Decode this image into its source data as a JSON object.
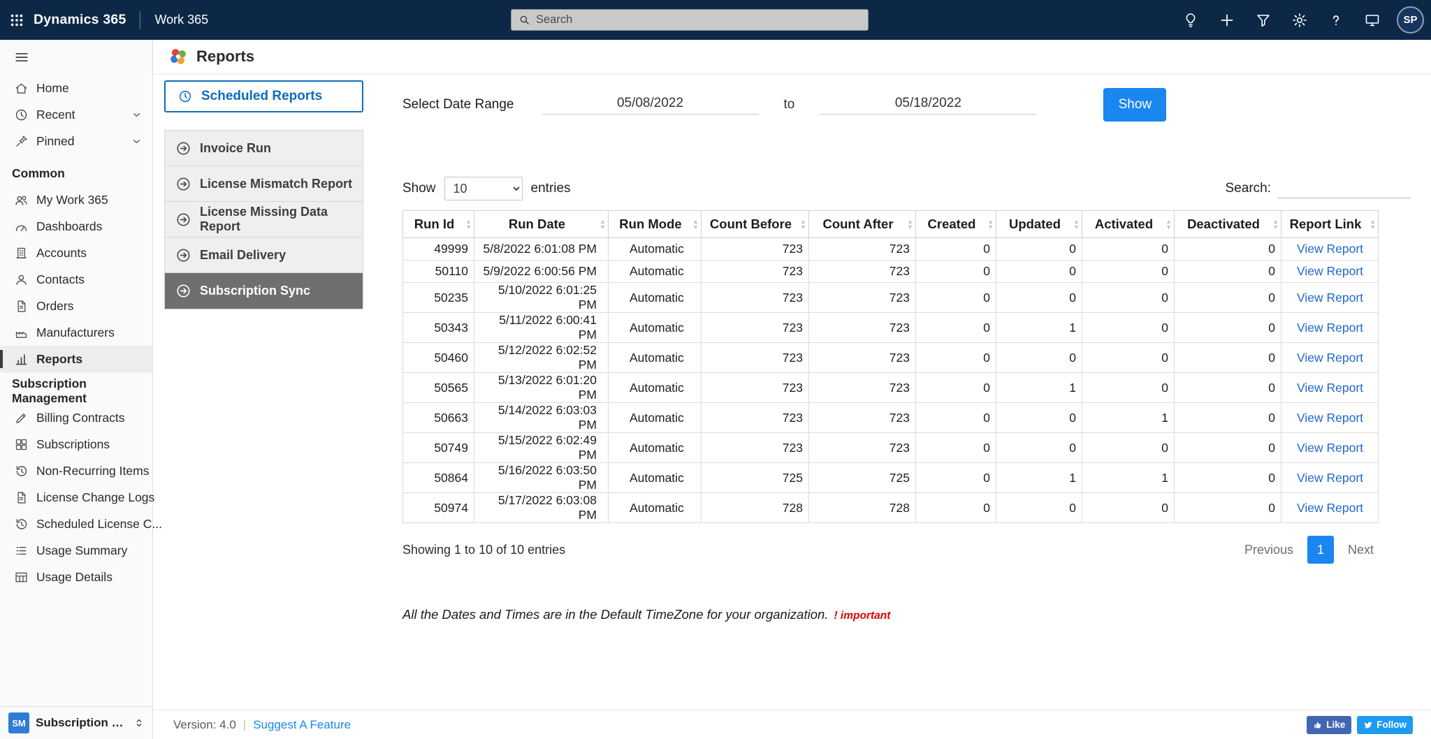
{
  "topbar": {
    "app_name": "Dynamics 365",
    "org_name": "Work 365",
    "search_placeholder": "Search",
    "avatar_initials": "SP"
  },
  "sidebar": {
    "items_top": [
      {
        "label": "Home",
        "icon": "home",
        "chevron": false
      },
      {
        "label": "Recent",
        "icon": "clock",
        "chevron": true
      },
      {
        "label": "Pinned",
        "icon": "pin",
        "chevron": true
      }
    ],
    "sections": [
      {
        "title": "Common",
        "items": [
          {
            "label": "My Work 365",
            "icon": "people"
          },
          {
            "label": "Dashboards",
            "icon": "gauge"
          },
          {
            "label": "Accounts",
            "icon": "building"
          },
          {
            "label": "Contacts",
            "icon": "person"
          },
          {
            "label": "Orders",
            "icon": "doc"
          },
          {
            "label": "Manufacturers",
            "icon": "factory"
          },
          {
            "label": "Reports",
            "icon": "chart"
          }
        ]
      },
      {
        "title": "Subscription Management",
        "items": [
          {
            "label": "Billing Contracts",
            "icon": "pen"
          },
          {
            "label": "Subscriptions",
            "icon": "grid"
          },
          {
            "label": "Non-Recurring Items",
            "icon": "history"
          },
          {
            "label": "License Change Logs",
            "icon": "doc"
          },
          {
            "label": "Scheduled License C...",
            "icon": "history"
          },
          {
            "label": "Usage Summary",
            "icon": "list"
          },
          {
            "label": "Usage Details",
            "icon": "table"
          }
        ]
      }
    ],
    "selected_item": "Reports",
    "footer": {
      "badge": "SM",
      "label": "Subscription Man..."
    }
  },
  "page": {
    "title": "Reports"
  },
  "report_nav": {
    "scheduled_label": "Scheduled Reports",
    "items": [
      "Invoice Run",
      "License Mismatch Report",
      "License Missing Data Report",
      "Email Delivery",
      "Subscription Sync"
    ],
    "selected": "Subscription Sync"
  },
  "filters": {
    "date_label": "Select Date Range",
    "date_from": "05/08/2022",
    "to_label": "to",
    "date_to": "05/18/2022",
    "show_button": "Show"
  },
  "table_controls": {
    "show_label": "Show",
    "page_size": "10",
    "entries_label": "entries",
    "search_label": "Search:"
  },
  "table": {
    "columns": [
      "Run Id",
      "Run Date",
      "Run Mode",
      "Count Before",
      "Count After",
      "Created",
      "Updated",
      "Activated",
      "Deactivated",
      "Report Link"
    ],
    "rows": [
      [
        "49999",
        "5/8/2022 6:01:08 PM",
        "Automatic",
        "723",
        "723",
        "0",
        "0",
        "0",
        "0",
        "View Report"
      ],
      [
        "50110",
        "5/9/2022 6:00:56 PM",
        "Automatic",
        "723",
        "723",
        "0",
        "0",
        "0",
        "0",
        "View Report"
      ],
      [
        "50235",
        "5/10/2022 6:01:25 PM",
        "Automatic",
        "723",
        "723",
        "0",
        "0",
        "0",
        "0",
        "View Report"
      ],
      [
        "50343",
        "5/11/2022 6:00:41 PM",
        "Automatic",
        "723",
        "723",
        "0",
        "1",
        "0",
        "0",
        "View Report"
      ],
      [
        "50460",
        "5/12/2022 6:02:52 PM",
        "Automatic",
        "723",
        "723",
        "0",
        "0",
        "0",
        "0",
        "View Report"
      ],
      [
        "50565",
        "5/13/2022 6:01:20 PM",
        "Automatic",
        "723",
        "723",
        "0",
        "1",
        "0",
        "0",
        "View Report"
      ],
      [
        "50663",
        "5/14/2022 6:03:03 PM",
        "Automatic",
        "723",
        "723",
        "0",
        "0",
        "1",
        "0",
        "View Report"
      ],
      [
        "50749",
        "5/15/2022 6:02:49 PM",
        "Automatic",
        "723",
        "723",
        "0",
        "0",
        "0",
        "0",
        "View Report"
      ],
      [
        "50864",
        "5/16/2022 6:03:50 PM",
        "Automatic",
        "725",
        "725",
        "0",
        "1",
        "1",
        "0",
        "View Report"
      ],
      [
        "50974",
        "5/17/2022 6:03:08 PM",
        "Automatic",
        "728",
        "728",
        "0",
        "0",
        "0",
        "0",
        "View Report"
      ]
    ],
    "summary": "Showing 1 to 10 of 10 entries",
    "pagination": {
      "previous": "Previous",
      "page": "1",
      "next": "Next"
    }
  },
  "notes": {
    "timezone": "All the Dates and Times are in the Default TimeZone for your organization.",
    "important": "! important"
  },
  "footer": {
    "version": "Version: 4.0",
    "suggest": "Suggest A Feature",
    "like": "Like",
    "follow": "Follow"
  },
  "colors": {
    "topbar_bg": "#0d2847",
    "accent_blue": "#1a86f0",
    "outline_blue": "#0f6cbd",
    "link_blue": "#2268cf",
    "selected_gray": "#6f6f6f",
    "important_red": "#e20000",
    "facebook_blue": "#4267b2",
    "twitter_blue": "#1d9bf0"
  }
}
